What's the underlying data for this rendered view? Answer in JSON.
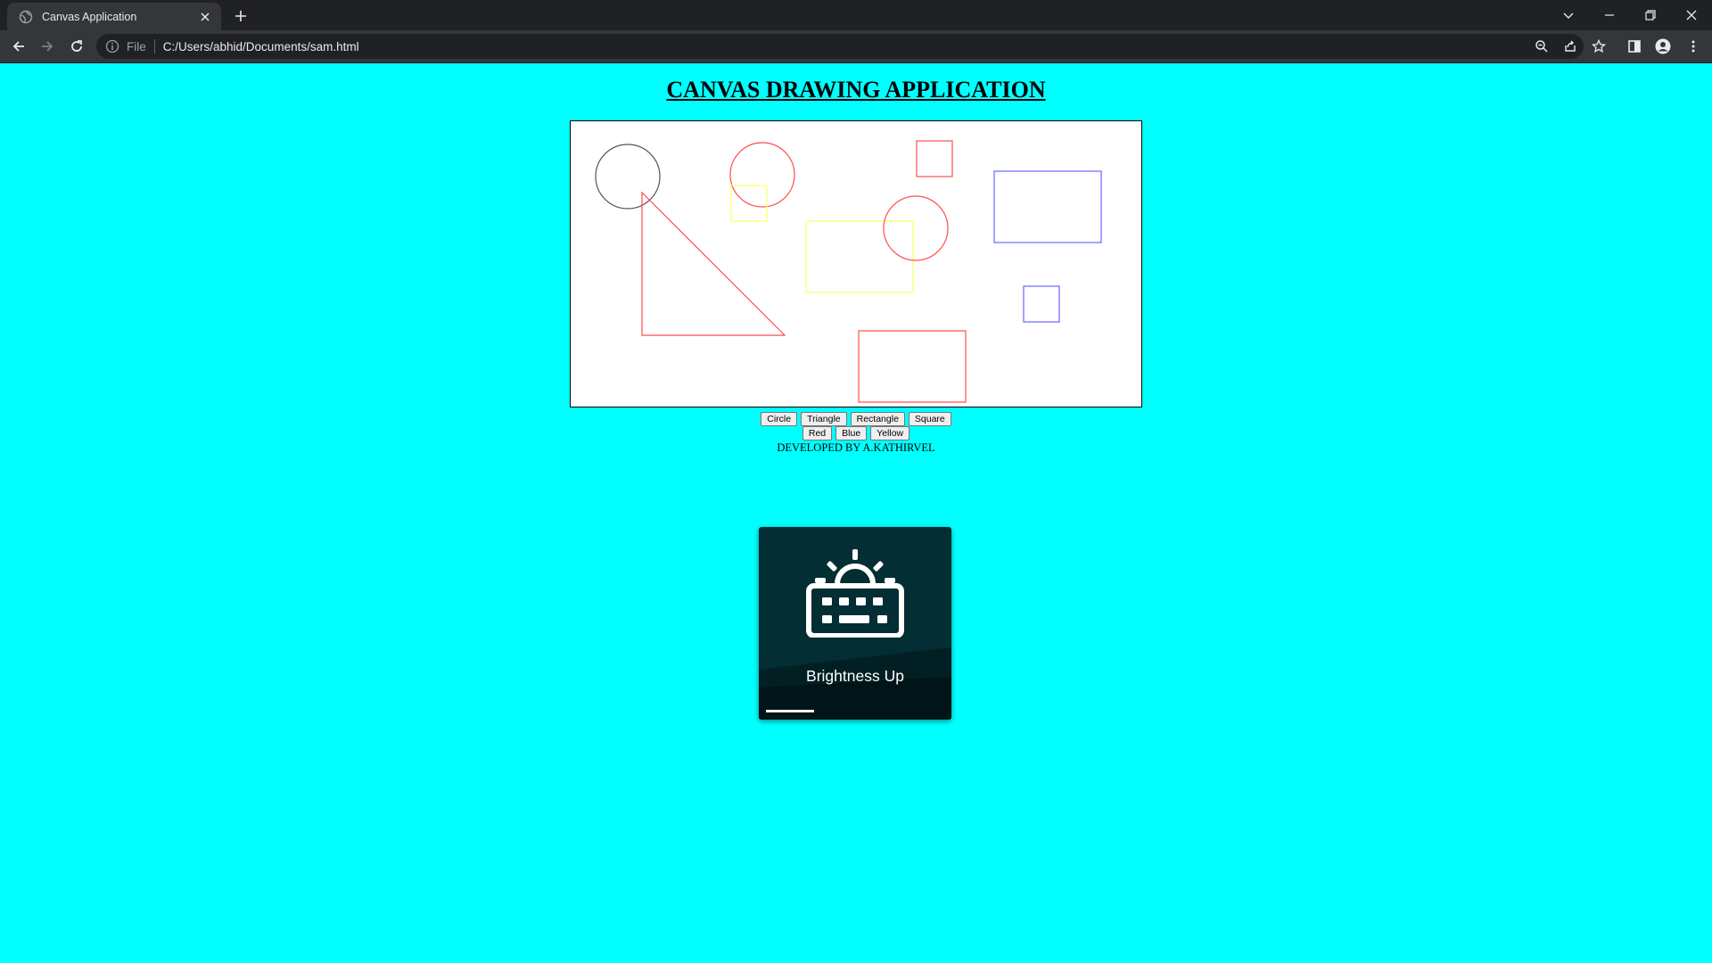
{
  "browser": {
    "tab_title": "Canvas Application",
    "scheme_label": "File",
    "url": "C:/Users/abhid/Documents/sam.html"
  },
  "page": {
    "title": "CANVAS DRAWING APPLICATION",
    "shape_buttons": [
      "Circle",
      "Triangle",
      "Rectangle",
      "Square"
    ],
    "color_buttons": [
      "Red",
      "Blue",
      "Yellow"
    ],
    "credit": "DEVELOPED BY A.KATHIRVEL",
    "background_color": "#00ffff"
  },
  "canvas_shapes": [
    {
      "type": "circle",
      "color": "#555555"
    },
    {
      "type": "circle",
      "color": "#ff4d4d"
    },
    {
      "type": "square",
      "color": "#ff4d4d"
    },
    {
      "type": "square",
      "color": "#ffff66"
    },
    {
      "type": "triangle",
      "color": "#ff4d4d"
    },
    {
      "type": "rectangle",
      "color": "#ffff66"
    },
    {
      "type": "circle",
      "color": "#ff4d4d"
    },
    {
      "type": "rectangle",
      "color": "#6666ff"
    },
    {
      "type": "square",
      "color": "#6666ff"
    },
    {
      "type": "rectangle",
      "color": "#ff4d4d"
    }
  ],
  "osd": {
    "label": "Brightness Up",
    "icon": "keyboard-brightness-icon",
    "level": 0.27
  }
}
